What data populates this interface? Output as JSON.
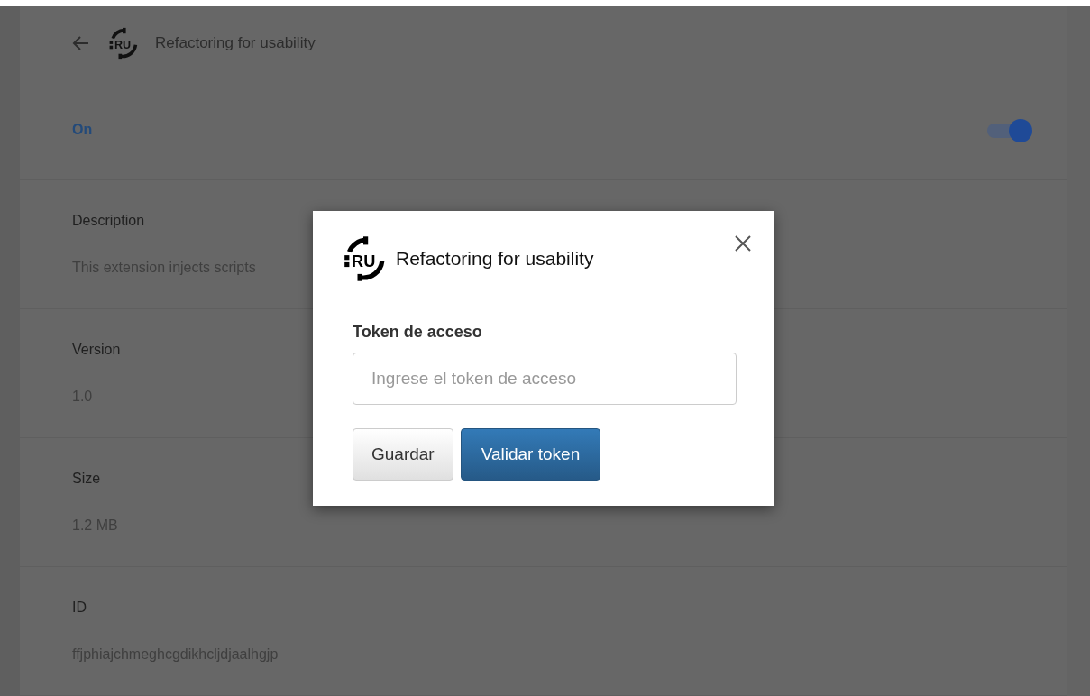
{
  "header": {
    "logo_text": "RU",
    "title": "Refactoring for usability"
  },
  "enabled": {
    "label": "On",
    "on": true
  },
  "sections": [
    {
      "label": "Description",
      "value": "This extension injects scripts"
    },
    {
      "label": "Version",
      "value": "1.0"
    },
    {
      "label": "Size",
      "value": "1.2 MB"
    },
    {
      "label": "ID",
      "value": "ffjphiajchmeghcgdikhcljdjaalhgjp"
    }
  ],
  "dialog": {
    "logo_text": "RU",
    "title": "Refactoring for usability",
    "field_label": "Token de acceso",
    "placeholder": "Ingrese el token de acceso",
    "buttons": [
      {
        "label": "Guardar",
        "kind": "default"
      },
      {
        "label": "Validar token",
        "kind": "primary"
      }
    ]
  }
}
